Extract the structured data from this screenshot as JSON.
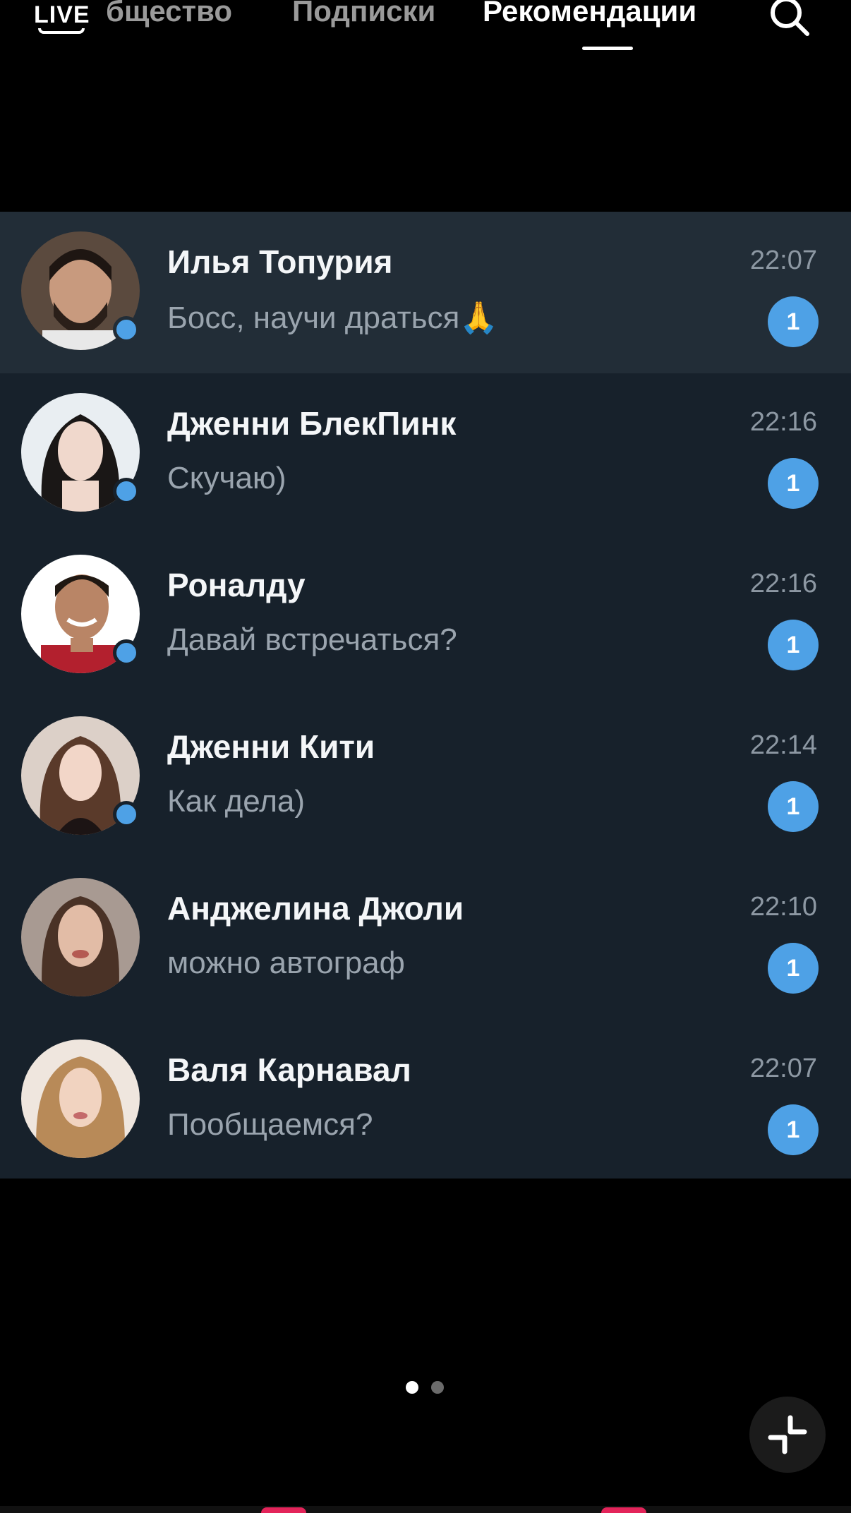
{
  "topbar": {
    "live_label": "LIVE",
    "tabs": [
      {
        "label": "Сообщество",
        "visible_label": "бщество",
        "active": false
      },
      {
        "label": "Подписки",
        "active": false
      },
      {
        "label": "Рекомендации",
        "active": true
      }
    ],
    "search_icon": "search-icon"
  },
  "chats": [
    {
      "name": "Илья Топурия",
      "message": "Босс, научи драться🙏",
      "time": "22:07",
      "unread": "1",
      "online": true,
      "highlighted": true
    },
    {
      "name": "Дженни БлекПинк",
      "message": "Скучаю)",
      "time": "22:16",
      "unread": "1",
      "online": true,
      "highlighted": false
    },
    {
      "name": "Роналду",
      "message": "Давай встречаться?",
      "time": "22:16",
      "unread": "1",
      "online": true,
      "highlighted": false
    },
    {
      "name": "Дженни Кити",
      "message": "Как дела)",
      "time": "22:14",
      "unread": "1",
      "online": true,
      "highlighted": false
    },
    {
      "name": "Анджелина Джоли",
      "message": "можно автограф",
      "time": "22:10",
      "unread": "1",
      "online": false,
      "highlighted": false
    },
    {
      "name": "Валя Карнавал",
      "message": "Пообщаемся?",
      "time": "22:07",
      "unread": "1",
      "online": false,
      "highlighted": false
    }
  ],
  "pager": {
    "current": 1,
    "total": 2
  },
  "colors": {
    "list_bg": "#17212b",
    "highlight_bg": "#222d37",
    "accent": "#4ea1e6",
    "muted_text": "#9aa4ae"
  },
  "collapse_icon": "collapse-icon"
}
